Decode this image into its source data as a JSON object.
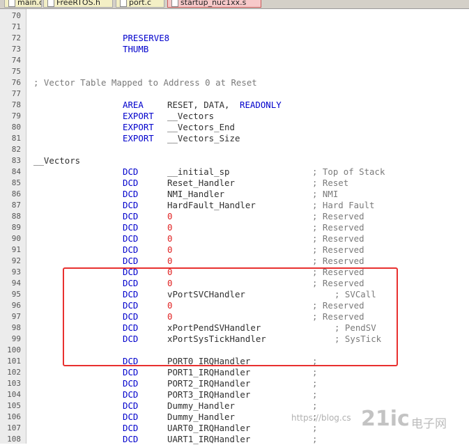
{
  "tabs": [
    {
      "label": "main.c",
      "active": false
    },
    {
      "label": "FreeRTOS.h",
      "active": false
    },
    {
      "label": "port.c",
      "active": false
    },
    {
      "label": "startup_nuc1xx.s",
      "active": true
    }
  ],
  "colors": {
    "keyword": "#0000cc",
    "text": "#303030",
    "comment": "#7a7a7a",
    "number": "#e02020",
    "highlight_box": "#e8302f"
  },
  "lines": [
    {
      "no": "70",
      "label": "",
      "op": "",
      "arg": "",
      "comment": ""
    },
    {
      "no": "71",
      "label": "",
      "op": "",
      "arg": "",
      "comment": ""
    },
    {
      "no": "72",
      "label": "",
      "op": "PRESERVE8",
      "arg": "",
      "comment": ""
    },
    {
      "no": "73",
      "label": "",
      "op": "THUMB",
      "arg": "",
      "comment": ""
    },
    {
      "no": "74",
      "label": "",
      "op": "",
      "arg": "",
      "comment": ""
    },
    {
      "no": "75",
      "label": "",
      "op": "",
      "arg": "",
      "comment": ""
    },
    {
      "no": "76",
      "label": "; Vector Table Mapped to Address 0 at Reset",
      "label_kind": "comment",
      "op": "",
      "arg": "",
      "comment": ""
    },
    {
      "no": "77",
      "label": "",
      "op": "",
      "arg": "",
      "comment": ""
    },
    {
      "no": "78",
      "label": "",
      "op": "AREA",
      "arg": "RESET, DATA,",
      "arg2": "READONLY",
      "comment": ""
    },
    {
      "no": "79",
      "label": "",
      "op": "EXPORT",
      "arg": "__Vectors",
      "comment": ""
    },
    {
      "no": "80",
      "label": "",
      "op": "EXPORT",
      "arg": "__Vectors_End",
      "comment": ""
    },
    {
      "no": "81",
      "label": "",
      "op": "EXPORT",
      "arg": "__Vectors_Size",
      "comment": ""
    },
    {
      "no": "82",
      "label": "",
      "op": "",
      "arg": "",
      "comment": ""
    },
    {
      "no": "83",
      "label": "__Vectors",
      "label_kind": "text",
      "op": "",
      "arg": "",
      "comment": ""
    },
    {
      "no": "84",
      "label": "",
      "op": "DCD",
      "arg": "__initial_sp",
      "comment": "; Top of Stack"
    },
    {
      "no": "85",
      "label": "",
      "op": "DCD",
      "arg": "Reset_Handler",
      "comment": "; Reset"
    },
    {
      "no": "86",
      "label": "",
      "op": "DCD",
      "arg": "NMI_Handler",
      "comment": "; NMI"
    },
    {
      "no": "87",
      "label": "",
      "op": "DCD",
      "arg": "HardFault_Handler",
      "comment": "; Hard Fault"
    },
    {
      "no": "88",
      "label": "",
      "op": "DCD",
      "arg": "0",
      "arg_kind": "number",
      "comment": "; Reserved"
    },
    {
      "no": "89",
      "label": "",
      "op": "DCD",
      "arg": "0",
      "arg_kind": "number",
      "comment": "; Reserved"
    },
    {
      "no": "90",
      "label": "",
      "op": "DCD",
      "arg": "0",
      "arg_kind": "number",
      "comment": "; Reserved"
    },
    {
      "no": "91",
      "label": "",
      "op": "DCD",
      "arg": "0",
      "arg_kind": "number",
      "comment": "; Reserved"
    },
    {
      "no": "92",
      "label": "",
      "op": "DCD",
      "arg": "0",
      "arg_kind": "number",
      "comment": "; Reserved"
    },
    {
      "no": "93",
      "label": "",
      "op": "DCD",
      "arg": "0",
      "arg_kind": "number",
      "comment": "; Reserved"
    },
    {
      "no": "94",
      "label": "",
      "op": "DCD",
      "arg": "0",
      "arg_kind": "number",
      "comment": "; Reserved"
    },
    {
      "no": "95",
      "label": "",
      "op": "DCD",
      "arg": "vPortSVCHandler",
      "comment": "; SVCall",
      "comment_shift": true
    },
    {
      "no": "96",
      "label": "",
      "op": "DCD",
      "arg": "0",
      "arg_kind": "number",
      "comment": "; Reserved"
    },
    {
      "no": "97",
      "label": "",
      "op": "DCD",
      "arg": "0",
      "arg_kind": "number",
      "comment": "; Reserved"
    },
    {
      "no": "98",
      "label": "",
      "op": "DCD",
      "arg": "xPortPendSVHandler",
      "comment": "; PendSV",
      "comment_shift": true
    },
    {
      "no": "99",
      "label": "",
      "op": "DCD",
      "arg": "xPortSysTickHandler",
      "comment": "; SysTick",
      "comment_shift": true
    },
    {
      "no": "100",
      "label": "",
      "op": "",
      "arg": "",
      "comment": ""
    },
    {
      "no": "101",
      "label": "",
      "op": "DCD",
      "arg": "PORT0_IRQHandler",
      "comment": ";"
    },
    {
      "no": "102",
      "label": "",
      "op": "DCD",
      "arg": "PORT1_IRQHandler",
      "comment": ";"
    },
    {
      "no": "103",
      "label": "",
      "op": "DCD",
      "arg": "PORT2_IRQHandler",
      "comment": ";"
    },
    {
      "no": "104",
      "label": "",
      "op": "DCD",
      "arg": "PORT3_IRQHandler",
      "comment": ";"
    },
    {
      "no": "105",
      "label": "",
      "op": "DCD",
      "arg": "Dummy_Handler",
      "comment": ";"
    },
    {
      "no": "106",
      "label": "",
      "op": "DCD",
      "arg": "Dummy_Handler",
      "comment": ";"
    },
    {
      "no": "107",
      "label": "",
      "op": "DCD",
      "arg": "UART0_IRQHandler",
      "comment": ";"
    },
    {
      "no": "108",
      "label": "",
      "op": "DCD",
      "arg": "UART1_IRQHandler",
      "comment": ";"
    }
  ],
  "watermark": "https://blog.cs",
  "brand": "21ic",
  "brand_cn": "电子网"
}
